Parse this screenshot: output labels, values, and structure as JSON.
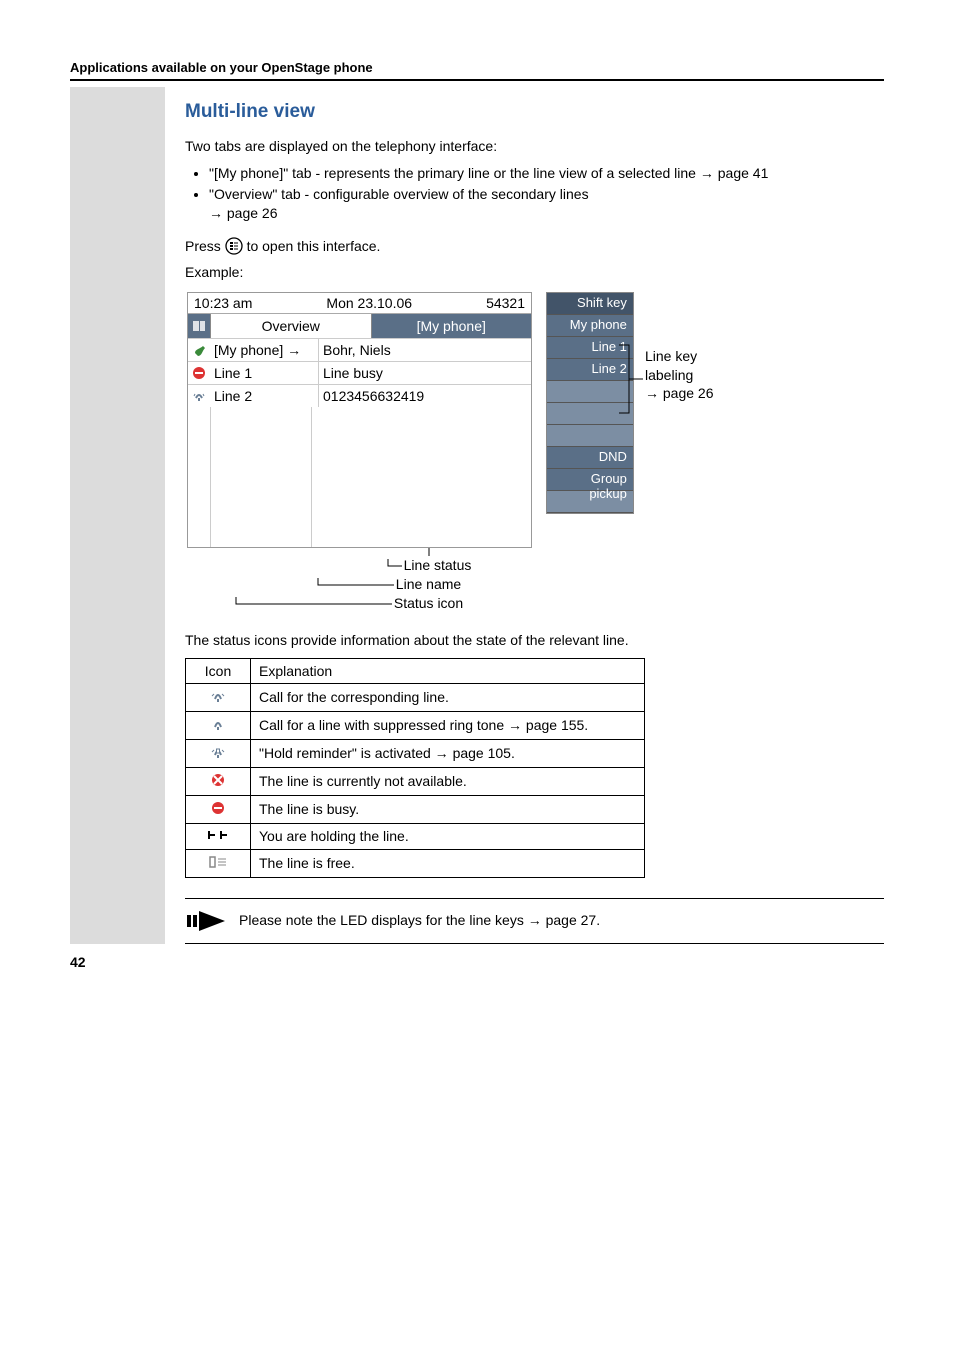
{
  "header": "Applications available on your OpenStage phone",
  "page_number": "42",
  "title": "Multi-line view",
  "intro": "Two tabs are displayed on the telephony interface:",
  "bullets": [
    {
      "text_a": "\"[My phone]\" tab - represents the primary line or the line view of a selected line ",
      "link": "→ page 41"
    },
    {
      "text_a": "\"Overview\" tab - configurable overview of the secondary lines ",
      "link": "→ page 26"
    }
  ],
  "press_line_a": "Press ",
  "press_line_b": " to open this interface.",
  "example_label": "Example:",
  "phone": {
    "time": "10:23 am",
    "date": "Mon 23.10.06",
    "number": "54321",
    "tab_inactive": "Overview",
    "tab_active": "[My phone]",
    "rows": [
      {
        "icon": "call",
        "name": "[My phone] →",
        "status": "Bohr, Niels"
      },
      {
        "icon": "busy",
        "name": "Line 1",
        "status": "Line busy"
      },
      {
        "icon": "ring",
        "name": "Line 2",
        "status": "0123456632419"
      }
    ],
    "keys": [
      "Shift key",
      "My phone",
      "Line 1",
      "Line 2",
      "",
      "",
      "",
      "DND",
      "Group pickup",
      ""
    ]
  },
  "annot": {
    "line1": "Line key",
    "line2": "labeling",
    "line3": "→ page 26"
  },
  "callouts": {
    "a": "Line status",
    "b": "Line name",
    "c": "Status icon"
  },
  "status_text": "The status icons provide information about the state of the relevant line.",
  "table": {
    "head_icon": "Icon",
    "head_exp": "Explanation",
    "rows": [
      {
        "icon": "bell-ring",
        "text": "Call for the corresponding line."
      },
      {
        "icon": "bell-mute",
        "text": "Call for a line with suppressed ring tone → page 155."
      },
      {
        "icon": "bell-hold",
        "text": "\"Hold reminder\" is activated → page 105."
      },
      {
        "icon": "unavailable",
        "text": "The line is currently not available."
      },
      {
        "icon": "busy",
        "text": "The line is busy."
      },
      {
        "icon": "hold",
        "text": "You are holding the line."
      },
      {
        "icon": "free",
        "text": "The line is free."
      }
    ]
  },
  "note": "Please note the LED displays for the line keys → page 27."
}
